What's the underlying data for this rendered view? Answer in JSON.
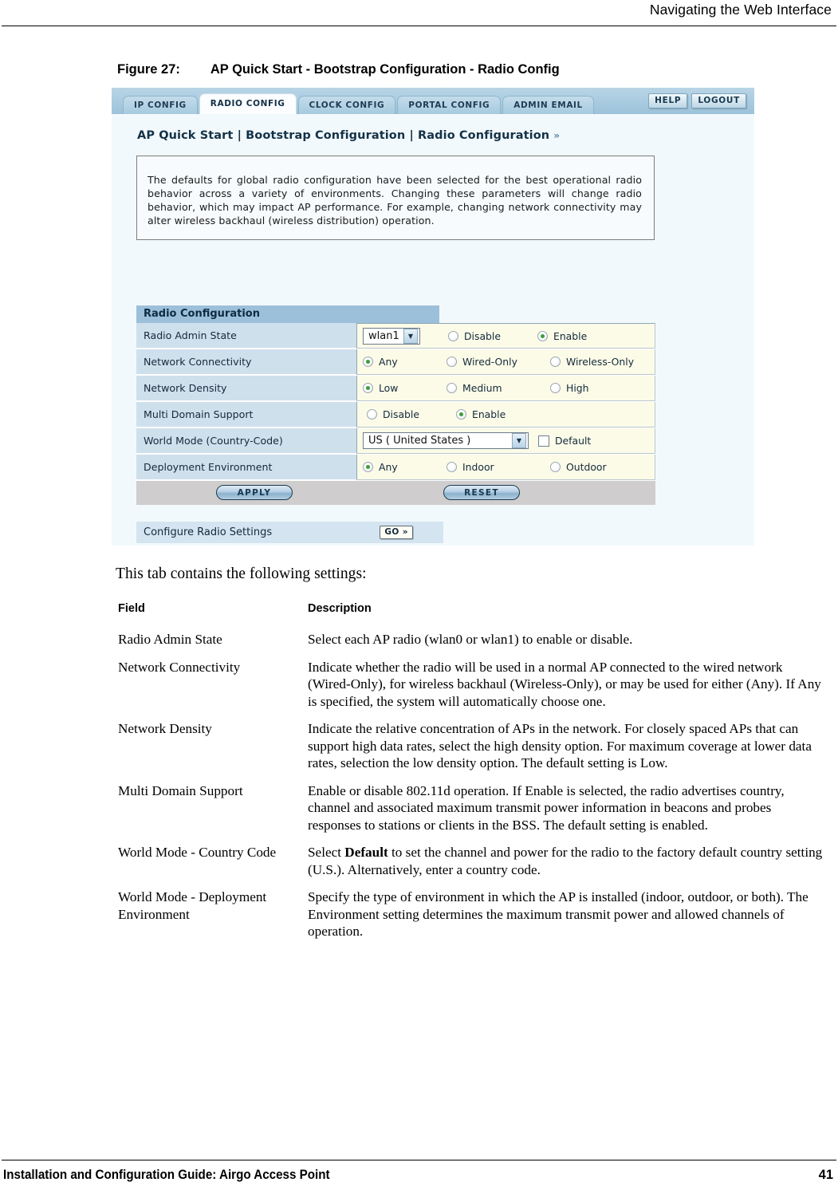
{
  "page": {
    "running_head": "Navigating the Web Interface",
    "footer_left": "Installation and Configuration Guide: Airgo Access Point",
    "footer_page_number": "41"
  },
  "figure": {
    "label": "Figure 27:",
    "title": "AP Quick Start - Bootstrap Configuration - Radio Config"
  },
  "screenshot": {
    "tabs": [
      {
        "label": "IP CONFIG",
        "active": false
      },
      {
        "label": "RADIO CONFIG",
        "active": true
      },
      {
        "label": "CLOCK CONFIG",
        "active": false
      },
      {
        "label": "PORTAL CONFIG",
        "active": false
      },
      {
        "label": "ADMIN EMAIL",
        "active": false
      }
    ],
    "help_button": "HELP",
    "logout_button": "LOGOUT",
    "breadcrumb": "AP Quick Start | Bootstrap Configuration | Radio Configuration",
    "breadcrumb_chevron": "»",
    "info_text": "The defaults for global radio configuration have been selected for the best operational radio behavior across a variety of environments. Changing these parameters will change radio behavior, which may impact AP performance. For example, changing network connectivity may alter wireless backhaul (wireless distribution) operation.",
    "section_title": "Radio Configuration",
    "rows": {
      "radio_admin_state": {
        "label": "Radio Admin State",
        "select_value": "wlan1",
        "options": [
          {
            "label": "Disable",
            "selected": false
          },
          {
            "label": "Enable",
            "selected": true
          }
        ]
      },
      "network_connectivity": {
        "label": "Network Connectivity",
        "options": [
          {
            "label": "Any",
            "selected": true
          },
          {
            "label": "Wired-Only",
            "selected": false
          },
          {
            "label": "Wireless-Only",
            "selected": false
          }
        ]
      },
      "network_density": {
        "label": "Network Density",
        "options": [
          {
            "label": "Low",
            "selected": true
          },
          {
            "label": "Medium",
            "selected": false
          },
          {
            "label": "High",
            "selected": false
          }
        ]
      },
      "multi_domain_support": {
        "label": "Multi Domain Support",
        "options": [
          {
            "label": "Disable",
            "selected": false
          },
          {
            "label": "Enable",
            "selected": true
          }
        ]
      },
      "world_mode": {
        "label": "World Mode (Country-Code)",
        "select_value": "US ( United States )",
        "checkbox_label": "Default",
        "checkbox_checked": false
      },
      "deployment_environment": {
        "label": "Deployment Environment",
        "options": [
          {
            "label": "Any",
            "selected": true
          },
          {
            "label": "Indoor",
            "selected": false
          },
          {
            "label": "Outdoor",
            "selected": false
          }
        ]
      }
    },
    "apply_button": "APPLY",
    "reset_button": "RESET",
    "go_row_label": "Configure Radio Settings",
    "go_button": "GO »",
    "colors": {
      "tab_inactive": "#a6cadf",
      "tab_active": "#fbfdfe",
      "section_header": "#9cc0da",
      "row_label_bg": "#cfe0ed",
      "row_control_bg": "#fbfbe8",
      "radio_selected_dot": "#3a9d3a",
      "button_bar_bg": "#cfcdcd"
    }
  },
  "body": {
    "lead_text": "This tab contains the following settings:",
    "table": {
      "headers": {
        "field": "Field",
        "description": "Description"
      },
      "rows": [
        {
          "field": "Radio Admin State",
          "description": "Select each AP radio (wlan0 or wlan1) to enable or disable."
        },
        {
          "field": "Network Connectivity",
          "description": "Indicate whether the radio will be used in a normal AP connected to the wired network (Wired-Only), for wireless backhaul (Wireless-Only), or may be used for either (Any). If Any is specified, the system will automatically choose one."
        },
        {
          "field": "Network Density",
          "description": "Indicate the relative concentration of APs in the network. For closely spaced APs that can support high data rates, select the high density option. For maximum coverage at lower data rates, selection the low density option. The default setting is Low."
        },
        {
          "field": "Multi Domain Support",
          "description": "Enable or disable 802.11d operation. If Enable is selected, the radio advertises country, channel and associated maximum transmit power information in beacons and probes responses to stations or clients in the BSS. The default setting is enabled."
        },
        {
          "field": "World Mode - Country Code",
          "description_prefix": "Select ",
          "description_bold": "Default",
          "description_suffix": " to set the channel and power for the radio to the factory default country setting (U.S.). Alternatively, enter a country code."
        },
        {
          "field": "World Mode - Deployment Environment",
          "description": "Specify the type of environment in which the AP is installed (indoor, outdoor, or both). The Environment setting determines the maximum transmit power and allowed channels of operation."
        }
      ]
    }
  }
}
